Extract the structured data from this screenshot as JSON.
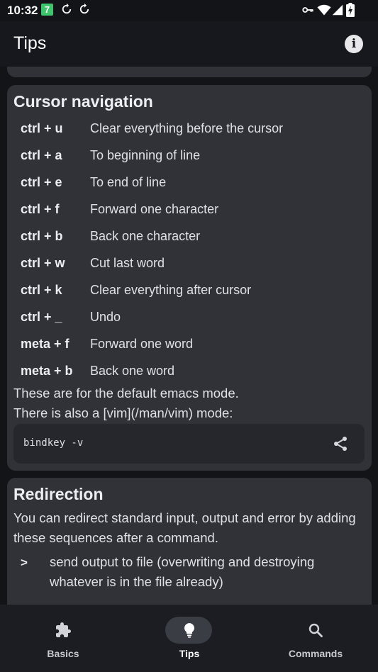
{
  "status_bar": {
    "time": "10:32",
    "badge": "7"
  },
  "app_bar": {
    "title": "Tips",
    "info_icon": "info-icon"
  },
  "cursor_card": {
    "title": "Cursor navigation",
    "shortcuts": [
      {
        "key": "ctrl + u",
        "desc": "Clear everything before the cursor"
      },
      {
        "key": "ctrl + a",
        "desc": "To beginning of line"
      },
      {
        "key": "ctrl + e",
        "desc": "To end of line"
      },
      {
        "key": "ctrl + f",
        "desc": "Forward one character"
      },
      {
        "key": "ctrl + b",
        "desc": "Back one character"
      },
      {
        "key": "ctrl + w",
        "desc": "Cut last word"
      },
      {
        "key": "ctrl + k",
        "desc": "Clear everything after cursor"
      },
      {
        "key": "ctrl + _",
        "desc": "Undo"
      },
      {
        "key": "meta + f",
        "desc": "Forward one word"
      },
      {
        "key": "meta + b",
        "desc": "Back one word"
      }
    ],
    "note_line1": "These are for the default emacs mode.",
    "note_line2": "There is also a [vim](/man/vim) mode:",
    "code": "bindkey -v"
  },
  "redirect_card": {
    "title": "Redirection",
    "intro": "You can redirect standard input, output and error by adding these sequences after a command.",
    "items": [
      {
        "symbol": ">",
        "text": "send output to file (overwriting and destroying whatever is in the file already)"
      }
    ]
  },
  "bottom_nav": {
    "items": [
      {
        "label": "Basics",
        "icon": "puzzle-icon",
        "active": false
      },
      {
        "label": "Tips",
        "icon": "lightbulb-icon",
        "active": true
      },
      {
        "label": "Commands",
        "icon": "search-icon",
        "active": false
      }
    ]
  },
  "colors": {
    "background": "#121418",
    "card": "#303238",
    "code_block": "#25272c",
    "active_pill": "#3a3d44",
    "badge": "#3ec46d"
  }
}
